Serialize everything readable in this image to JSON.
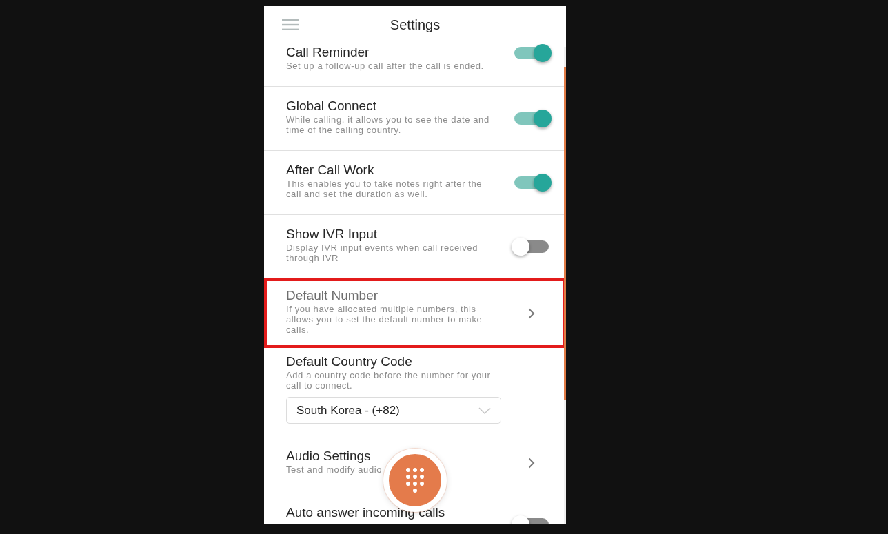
{
  "header": {
    "title": "Settings"
  },
  "settings": [
    {
      "kind": "toggle",
      "title": "Call Reminder",
      "description": "Set up a follow-up call after the call is ended.",
      "on": true,
      "highlighted": false
    },
    {
      "kind": "toggle",
      "title": "Global Connect",
      "description": "While calling, it allows you to see the date and time of the calling country.",
      "on": true,
      "highlighted": false
    },
    {
      "kind": "toggle",
      "title": "After Call Work",
      "description": "This enables you to take notes right after the call and set the duration as well.",
      "on": true,
      "highlighted": false
    },
    {
      "kind": "toggle",
      "title": "Show IVR Input",
      "description": "Display IVR input events when call received through IVR",
      "on": false,
      "highlighted": false
    },
    {
      "kind": "link",
      "title": "Default Number",
      "description": "If you have allocated multiple numbers, this allows you to set the default number to make calls.",
      "highlighted": true
    },
    {
      "kind": "select",
      "title": "Default Country Code",
      "description": "Add a country code before the number for your call to connect.",
      "value": "South Korea - (+82)",
      "highlighted": false
    },
    {
      "kind": "link",
      "title": "Audio Settings",
      "description": "Test and modify audio",
      "highlighted": false
    },
    {
      "kind": "toggle",
      "title": "Auto answer incoming calls",
      "on": false,
      "highlighted": false
    }
  ]
}
